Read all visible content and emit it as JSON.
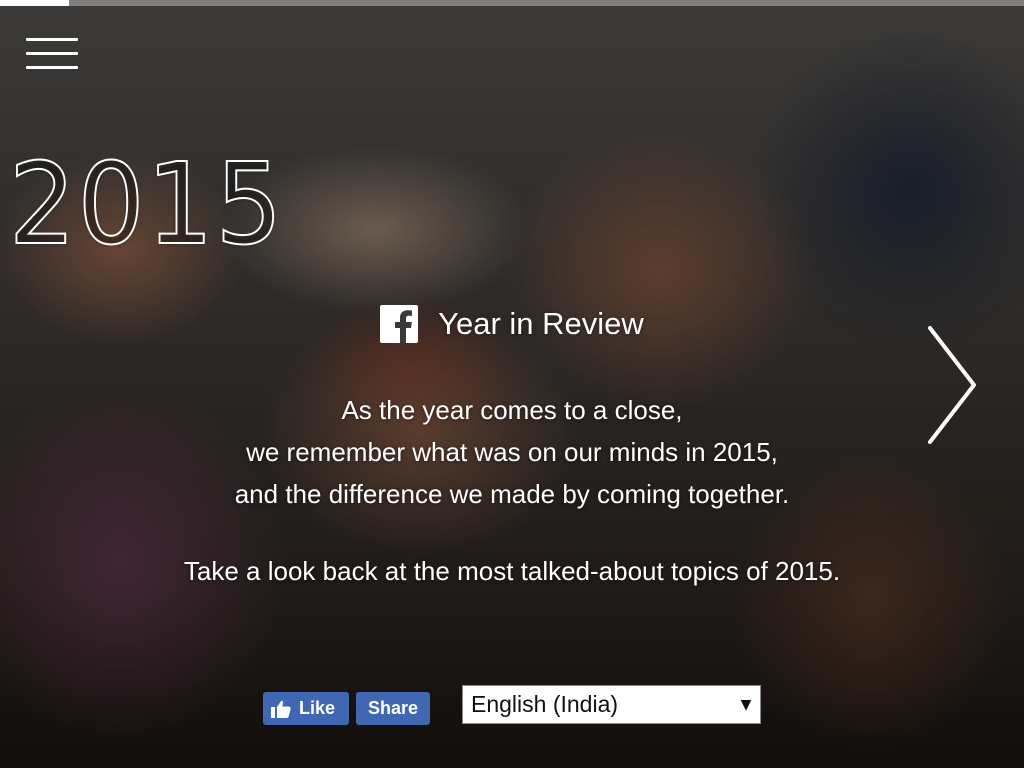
{
  "header": {
    "progress_fraction": 0.067
  },
  "hero": {
    "year": "2015",
    "title": "Year in Review",
    "intro_lines": [
      "As the year comes to a close,",
      "we remember what was on our minds in 2015,",
      "and the difference we made by coming together."
    ],
    "cta": "Take a look back at the most talked-about topics of 2015."
  },
  "social": {
    "like_label": "Like",
    "share_label": "Share"
  },
  "language": {
    "selected": "English (India)"
  },
  "icons": {
    "menu": "hamburger-menu-icon",
    "next": "chevron-right-icon",
    "brand": "facebook-logo-icon",
    "like": "thumbs-up-icon",
    "dropdown": "triangle-down-icon"
  },
  "colors": {
    "facebook_blue": "#4267b2",
    "text": "#ffffff"
  }
}
